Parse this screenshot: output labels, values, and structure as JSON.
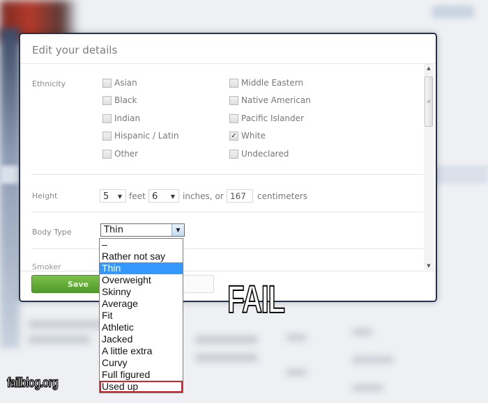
{
  "dialog": {
    "title": "Edit your details",
    "ethnicity": {
      "label": "Ethnicity",
      "options": [
        {
          "label": "Asian",
          "checked": false
        },
        {
          "label": "Black",
          "checked": false
        },
        {
          "label": "Indian",
          "checked": false
        },
        {
          "label": "Hispanic / Latin",
          "checked": false
        },
        {
          "label": "Other",
          "checked": false
        },
        {
          "label": "Middle Eastern",
          "checked": false
        },
        {
          "label": "Native American",
          "checked": false
        },
        {
          "label": "Pacific Islander",
          "checked": false
        },
        {
          "label": "White",
          "checked": true
        },
        {
          "label": "Undeclared",
          "checked": false
        }
      ]
    },
    "height": {
      "label": "Height",
      "feet_value": "5",
      "feet_label": "feet",
      "inches_value": "6",
      "inches_label": "inches, or",
      "cm_value": "167",
      "cm_label": "centimeters"
    },
    "body_type": {
      "label": "Body Type",
      "selected": "Thin",
      "options": [
        "–",
        "Rather not say",
        "Thin",
        "Overweight",
        "Skinny",
        "Average",
        "Fit",
        "Athletic",
        "Jacked",
        "A little extra",
        "Curvy",
        "Full figured",
        "Used up"
      ],
      "highlighted_option": "Used up"
    },
    "next_label_partial": "Smoker",
    "save_label": "Save",
    "checkmark_glyph": "✓",
    "arrow_glyph": "▼",
    "scroll_up_glyph": "▲",
    "scroll_down_glyph": "▼",
    "thumb_grip_glyph": "≡"
  },
  "overlay": {
    "fail_text": "FAIL",
    "watermark": "failblog.org"
  },
  "colors": {
    "save_green": "#5aa831",
    "selection_blue": "#3399ff",
    "highlight_red": "#d2232a",
    "dialog_border": "#23324f"
  }
}
